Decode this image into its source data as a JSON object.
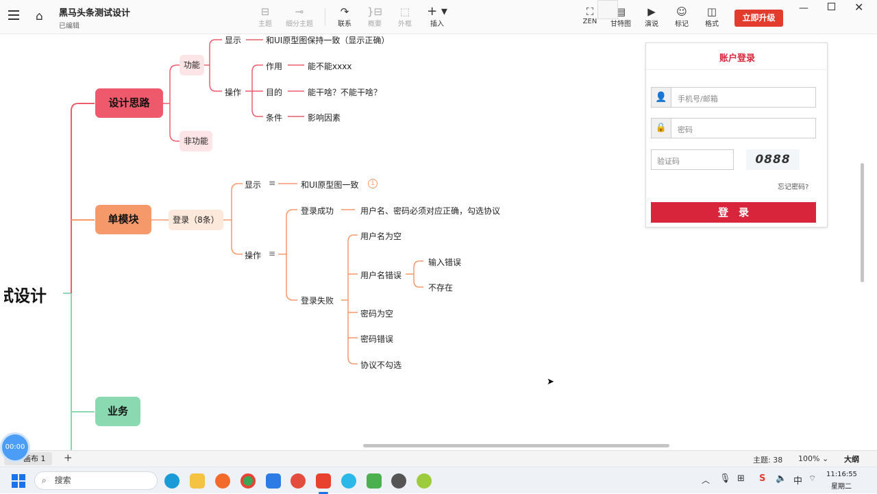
{
  "window": {
    "doc_title": "黑马头条测试设计",
    "doc_status": "已编辑",
    "upgrade_label": "立即升级"
  },
  "toolbar": [
    {
      "label": "主题",
      "icon": "topic-icon",
      "disabled": true
    },
    {
      "label": "细分主题",
      "icon": "subtopic-icon",
      "disabled": true
    },
    {
      "label": "联系",
      "icon": "relation-icon",
      "disabled": false
    },
    {
      "label": "概要",
      "icon": "summary-icon",
      "disabled": true
    },
    {
      "label": "外框",
      "icon": "boundary-icon",
      "disabled": true
    },
    {
      "label": "插入",
      "icon": "insert-icon",
      "disabled": false
    }
  ],
  "toolbar_right": [
    {
      "label": "ZEN",
      "icon": "zen-icon"
    },
    {
      "label": "甘特图",
      "icon": "gantt-icon"
    },
    {
      "label": "演说",
      "icon": "pitch-icon"
    },
    {
      "label": "标记",
      "icon": "marker-icon"
    },
    {
      "label": "格式",
      "icon": "format-icon"
    }
  ],
  "mindmap": {
    "root": "试设计",
    "branches": {
      "design": "设计思路",
      "single": "单模块",
      "business": "业务"
    },
    "design": {
      "func": "功能",
      "nonfunc": "非功能",
      "display": "显示",
      "display_text": "和UI原型图保持一致（显示正确）",
      "operate": "操作",
      "op_items": [
        {
          "k": "作用",
          "v": "能不能xxxx"
        },
        {
          "k": "目的",
          "v": "能干啥？不能干啥？"
        },
        {
          "k": "条件",
          "v": "影响因素"
        }
      ]
    },
    "single": {
      "login": "登录（8条）",
      "display": "显示",
      "display_text": "和UI原型图一致",
      "display_badge": "1",
      "operate": "操作",
      "success": "登录成功",
      "success_text": "用户名、密码必须对应正确，勾选协议",
      "fail": "登录失败",
      "fail_items": [
        "用户名为空",
        "用户名错误",
        "密码为空",
        "密码错误",
        "协议不勾选"
      ],
      "user_err": [
        "输入错误",
        "不存在"
      ]
    }
  },
  "login_panel": {
    "title": "账户登录",
    "phone_placeholder": "手机号/邮箱",
    "password_placeholder": "密码",
    "captcha_placeholder": "验证码",
    "captcha_text": "0888",
    "forgot": "忘记密码?",
    "submit": "登　录"
  },
  "statusbar": {
    "sheet": "画布 1",
    "add": "+",
    "topics": "主题: 38",
    "zoom": "100%",
    "outline": "大纲",
    "timer": "00:00"
  },
  "taskbar": {
    "search": "搜索",
    "time": "11:16:55",
    "day": "星期二"
  },
  "colors": {
    "design": "#ee5a6b",
    "single": "#f5996b",
    "business": "#8ad9b0",
    "accent": "#d9253b"
  }
}
